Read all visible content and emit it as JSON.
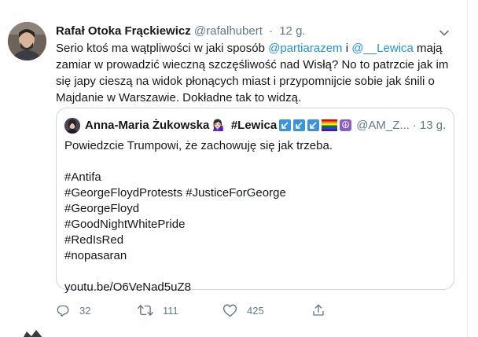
{
  "colors": {
    "accent": "#1b95e0",
    "secondary_text": "#657786",
    "border": "#ccd6dd",
    "text": "#14171a"
  },
  "tweet": {
    "author_name": "Rafał Otoka Frąckiewicz",
    "author_handle": "@rafalhubert",
    "separator": "·",
    "time": "12 g.",
    "body": {
      "part1": "Serio ktoś ma wątpliwości w jaki sposób ",
      "mention1": "@partiarazem",
      "part2": " i ",
      "mention2": "@__Lewica",
      "part3": " mają zamiar w prowadzić wieczną szczęśliwość nad Wisłą? No to patrzcie jak im się japy cieszą na widok płonących miast i przypomnijcie sobie jak śnili o Majdanie w Warszawie. Dokładne tak to widzą."
    }
  },
  "quote": {
    "author_name": "Anna-Maria Żukowska",
    "emoji": "💁🏻‍♀️",
    "tag": "#Lewica",
    "handle": "@AM_Z...",
    "separator": "·",
    "time": "13 g.",
    "lines": [
      "Powiedzcie Trumpowi, że zachowuję się jak trzeba.",
      "",
      "#Antifa",
      "#GeorgeFloydProtests #JusticeForGeorge",
      "#GeorgeFloyd",
      "#GoodNightWhitePride",
      "#RedIsRed",
      "#nopasaran",
      "",
      "youtu.be/O6VeNad5uZ8"
    ]
  },
  "actions": {
    "reply_count": "32",
    "retweet_count": "111",
    "like_count": "425"
  },
  "icons": [
    "caret-down-icon",
    "reply-icon",
    "retweet-icon",
    "like-icon",
    "share-icon",
    "arrow-badge-icon",
    "rainbow-flag-icon",
    "peace-icon"
  ]
}
